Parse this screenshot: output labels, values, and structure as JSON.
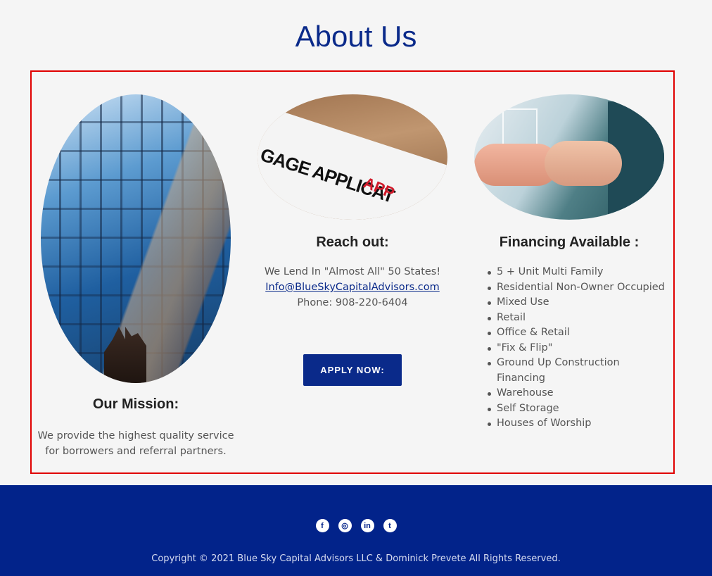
{
  "page": {
    "title": "About Us",
    "colors": {
      "brand": "#0a2a8a",
      "footer": "#02238a",
      "highlight": "#e00000"
    }
  },
  "mission": {
    "image_icon": "skyscraper-photo",
    "title": "Our Mission:",
    "text": "We provide the highest quality service for borrowers and referral partners."
  },
  "reach": {
    "image_icon": "mortgage-application-photo",
    "image_text": "GAGE APPLICAT",
    "image_stamp": "APP",
    "title": "Reach out:",
    "line1": "We Lend In \"Almost All\" 50 States!",
    "email": "Info@BlueSkyCapitalAdvisors.com",
    "phone": "Phone: 908-220-6404",
    "apply_label": "APPLY NOW:"
  },
  "financing": {
    "image_icon": "handshake-photo",
    "title": "Financing Available :",
    "items": [
      "5 + Unit Multi Family",
      "Residential Non-Owner Occupied",
      "Mixed Use",
      "Retail",
      "Office & Retail",
      "\"Fix & Flip\"",
      "Ground Up Construction Financing",
      "Warehouse",
      "Self Storage",
      "Houses of Worship"
    ]
  },
  "footer": {
    "social": [
      {
        "name": "facebook-icon",
        "glyph": "f"
      },
      {
        "name": "instagram-icon",
        "glyph": "◎"
      },
      {
        "name": "linkedin-icon",
        "glyph": "in"
      },
      {
        "name": "twitter-icon",
        "glyph": "t"
      }
    ],
    "copyright": "Copyright © 2021 Blue Sky Capital Advisors LLC & Dominick Prevete All Rights Reserved."
  }
}
